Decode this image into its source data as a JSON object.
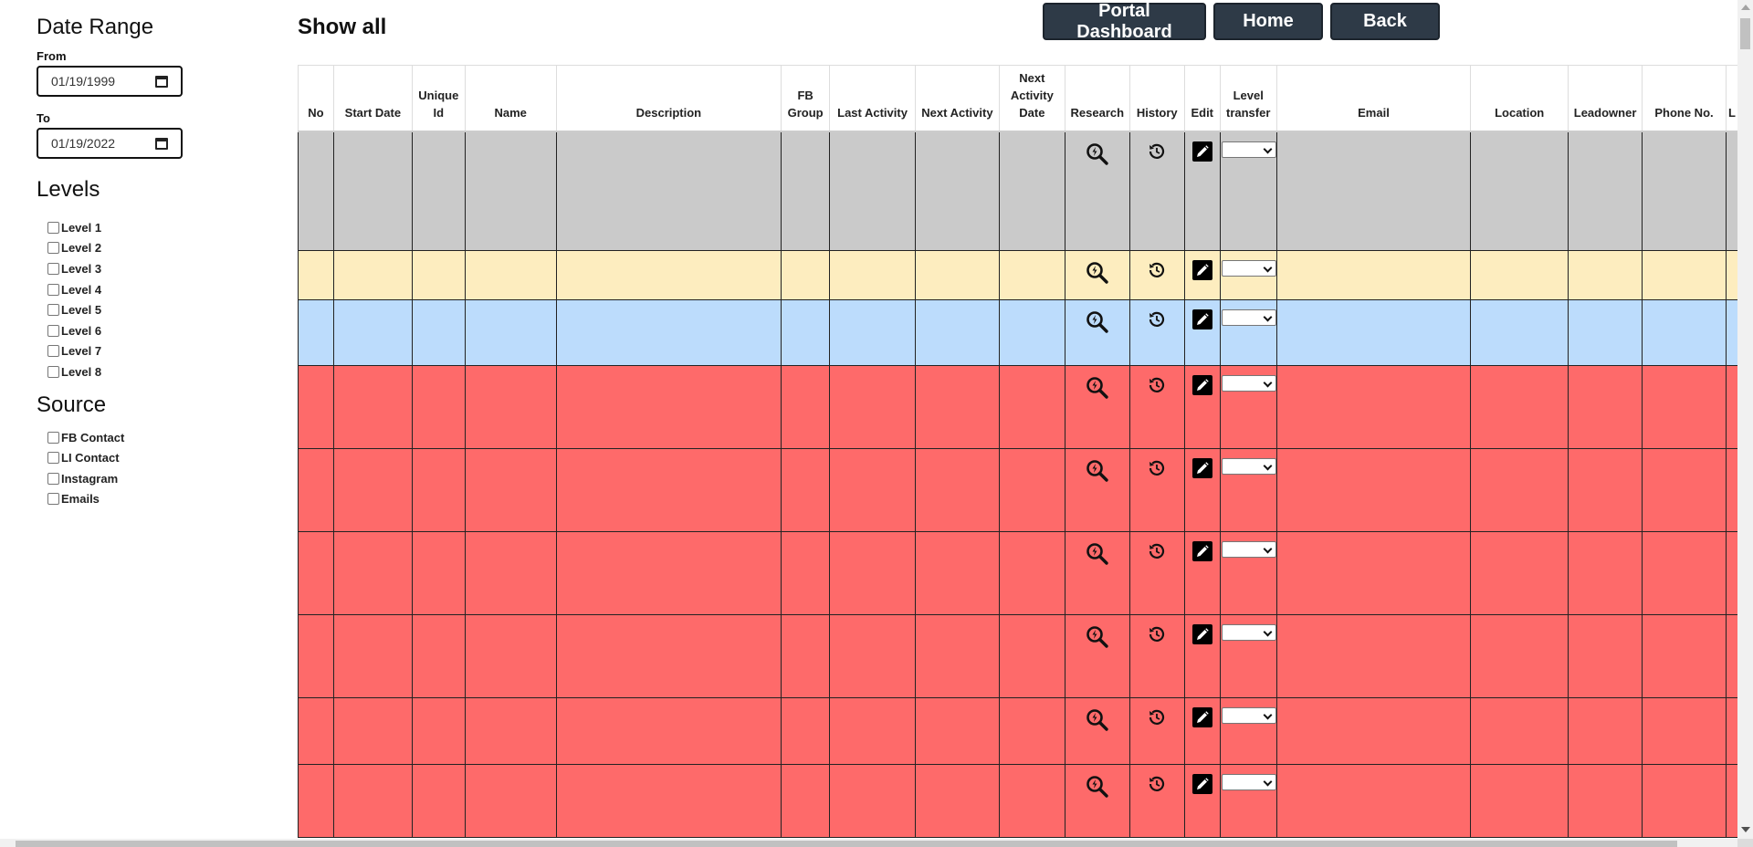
{
  "sidebar": {
    "date_range_title": "Date Range",
    "from_label": "From",
    "from_value": "01/19/1999",
    "to_label": "To",
    "to_value": "01/19/2022",
    "levels_title": "Levels",
    "levels": [
      "Level 1",
      "Level 2",
      "Level 3",
      "Level 4",
      "Level 5",
      "Level 6",
      "Level 7",
      "Level 8"
    ],
    "source_title": "Source",
    "sources": [
      "FB Contact",
      "LI Contact",
      "Instagram",
      "Emails"
    ]
  },
  "header": {
    "title": "Show all",
    "buttons": {
      "portal": "Portal Dashboard",
      "home": "Home",
      "back": "Back"
    }
  },
  "table": {
    "columns": [
      "No",
      "Start Date",
      "Unique Id",
      "Name",
      "Description",
      "FB Group",
      "Last Activity",
      "Next Activity",
      "Next Activity Date",
      "Research",
      "History",
      "Edit",
      "Level transfer",
      "Email",
      "Location",
      "Leadowner",
      "Phone No.",
      "L"
    ],
    "rows": [
      {
        "color": "#cacaca"
      },
      {
        "color": "#fdedbf"
      },
      {
        "color": "#bcdcfc"
      },
      {
        "color": "#fe6a6a"
      },
      {
        "color": "#fe6a6a"
      },
      {
        "color": "#fe6a6a"
      },
      {
        "color": "#fe6a6a"
      },
      {
        "color": "#fe6a6a"
      },
      {
        "color": "#fe6a6a"
      }
    ]
  },
  "colors": {
    "button_bg": "#2e3a47",
    "row_gray": "#cacaca",
    "row_yellow": "#fdedbf",
    "row_blue": "#bcdcfc",
    "row_red": "#fe6a6a"
  }
}
